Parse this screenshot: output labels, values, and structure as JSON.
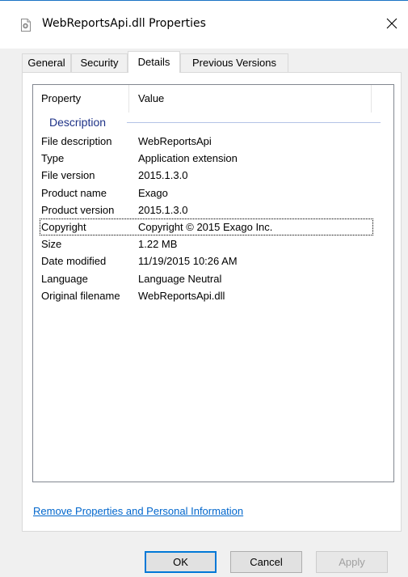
{
  "window": {
    "title": "WebReportsApi.dll Properties",
    "title_icon": "dll-file-icon",
    "close_glyph": "✕"
  },
  "tabs": [
    {
      "label": "General",
      "active": false
    },
    {
      "label": "Security",
      "active": false
    },
    {
      "label": "Details",
      "active": true
    },
    {
      "label": "Previous Versions",
      "active": false
    }
  ],
  "details": {
    "columns": {
      "property": "Property",
      "value": "Value"
    },
    "group_label": "Description",
    "rows": [
      {
        "property": "File description",
        "value": "WebReportsApi"
      },
      {
        "property": "Type",
        "value": "Application extension"
      },
      {
        "property": "File version",
        "value": "2015.1.3.0"
      },
      {
        "property": "Product name",
        "value": "Exago"
      },
      {
        "property": "Product version",
        "value": "2015.1.3.0"
      },
      {
        "property": "Copyright",
        "value": "Copyright © 2015 Exago Inc.",
        "focused": true
      },
      {
        "property": "Size",
        "value": "1.22 MB"
      },
      {
        "property": "Date modified",
        "value": "11/19/2015 10:26 AM"
      },
      {
        "property": "Language",
        "value": "Language Neutral"
      },
      {
        "property": "Original filename",
        "value": "WebReportsApi.dll"
      }
    ]
  },
  "remove_link": "Remove Properties and Personal Information",
  "buttons": {
    "ok": "OK",
    "cancel": "Cancel",
    "apply": "Apply",
    "apply_enabled": false
  },
  "colors": {
    "link": "#0066cc",
    "group_header": "#1e3287",
    "default_button_border": "#0078d7"
  }
}
